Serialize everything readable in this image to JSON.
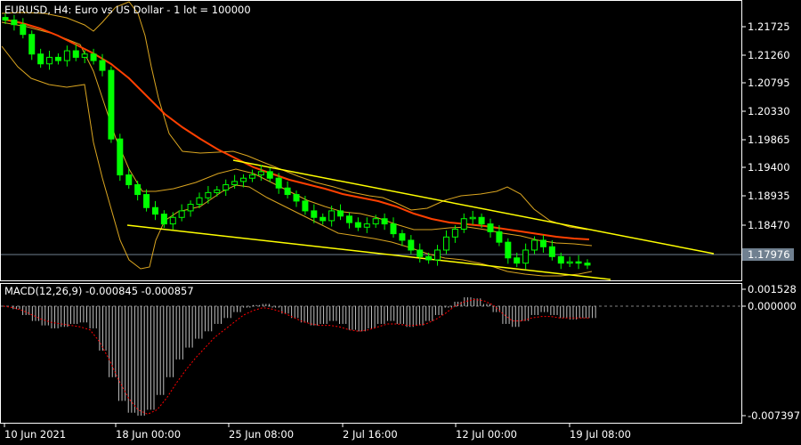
{
  "header": {
    "symbol_info": "EURUSD, H4:  Euro vs US Dollar - 1 lot = 100000"
  },
  "macd": {
    "label": "MACD(12,26,9) -0.000845 -0.000857"
  },
  "price_axis": {
    "labels": [
      "1.21725",
      "1.21260",
      "1.20795",
      "1.20330",
      "1.19865",
      "1.19400",
      "1.18935",
      "1.18470"
    ],
    "current_price": "1.17976"
  },
  "macd_axis": {
    "labels": [
      "0.001528",
      "0.000000",
      "-0.007397"
    ]
  },
  "time_axis": {
    "labels": [
      "10 Jun 2021",
      "18 Jun 00:00",
      "25 Jun 08:00",
      "2 Jul 16:00",
      "12 Jul 00:00",
      "19 Jul 08:00"
    ]
  },
  "colors": {
    "background": "#000000",
    "bull_candle": "#00ff00",
    "bear_candle": "#00ff00",
    "moving_average": "#ff4000",
    "bollinger_bands": "#daa520",
    "channel_lines": "#ffff00",
    "macd_histogram": "#c0c0c0",
    "macd_signal": "#ff0000",
    "grid_text": "#ffffff",
    "current_price_line": "#708090"
  },
  "chart_data": {
    "type": "candlestick",
    "symbol": "EURUSD",
    "timeframe": "H4",
    "ylim": [
      1.1775,
      1.22
    ],
    "close_series": [
      1.2172,
      1.2165,
      1.215,
      1.212,
      1.2105,
      1.2115,
      1.211,
      1.2125,
      1.2115,
      1.212,
      1.211,
      1.2095,
      1.199,
      1.1935,
      1.192,
      1.1905,
      1.1885,
      1.1875,
      1.186,
      1.187,
      1.188,
      1.189,
      1.19,
      1.1908,
      1.1912,
      1.192,
      1.1925,
      1.193,
      1.1935,
      1.194,
      1.193,
      1.1915,
      1.1905,
      1.1895,
      1.188,
      1.187,
      1.1865,
      1.188,
      1.1872,
      1.1862,
      1.1855,
      1.186,
      1.1868,
      1.186,
      1.1845,
      1.1835,
      1.182,
      1.181,
      1.1805,
      1.182,
      1.184,
      1.1852,
      1.1868,
      1.187,
      1.186,
      1.1848,
      1.1832,
      1.1808,
      1.18,
      1.182,
      1.1835,
      1.1825,
      1.181,
      1.18,
      1.1802,
      1.18,
      1.1797
    ],
    "macd_histogram": [
      0.0,
      -0.0002,
      -0.0006,
      -0.001,
      -0.0013,
      -0.0015,
      -0.0014,
      -0.0012,
      -0.0011,
      -0.0015,
      -0.003,
      -0.0048,
      -0.0064,
      -0.0072,
      -0.0074,
      -0.007,
      -0.006,
      -0.0048,
      -0.0036,
      -0.0028,
      -0.0022,
      -0.0017,
      -0.0012,
      -0.0008,
      -0.0004,
      -0.0001,
      0.0001,
      0.0002,
      -0.0001,
      -0.0005,
      -0.0008,
      -0.0011,
      -0.0013,
      -0.0012,
      -0.001,
      -0.0012,
      -0.0016,
      -0.0017,
      -0.0015,
      -0.0012,
      -0.001,
      -0.0012,
      -0.0014,
      -0.0013,
      -0.001,
      -0.0006,
      -0.0001,
      0.0004,
      0.0008,
      0.0007,
      0.0002,
      -0.0004,
      -0.0012,
      -0.0014,
      -0.001,
      -0.0006,
      -0.0004,
      -0.0006,
      -0.0008,
      -0.0009,
      -0.0008,
      -0.0008
    ],
    "macd_signal": [
      0.0,
      -0.0001,
      -0.0003,
      -0.0006,
      -0.0009,
      -0.0011,
      -0.0012,
      -0.0013,
      -0.0014,
      -0.0016,
      -0.0024,
      -0.0036,
      -0.005,
      -0.0062,
      -0.007,
      -0.0073,
      -0.007,
      -0.0062,
      -0.0052,
      -0.0043,
      -0.0035,
      -0.0028,
      -0.0021,
      -0.0016,
      -0.0011,
      -0.0006,
      -0.0003,
      -0.0001,
      -0.0002,
      -0.0004,
      -0.0007,
      -0.001,
      -0.0012,
      -0.0013,
      -0.0013,
      -0.0014,
      -0.0016,
      -0.0017,
      -0.0016,
      -0.0014,
      -0.0012,
      -0.0012,
      -0.0013,
      -0.0013,
      -0.0012,
      -0.0009,
      -0.0005,
      0.0,
      0.0004,
      0.0006,
      0.0005,
      0.0001,
      -0.0005,
      -0.001,
      -0.001,
      -0.0008,
      -0.0007,
      -0.0007,
      -0.0008,
      -0.0008,
      -0.0008,
      -0.0008
    ]
  }
}
